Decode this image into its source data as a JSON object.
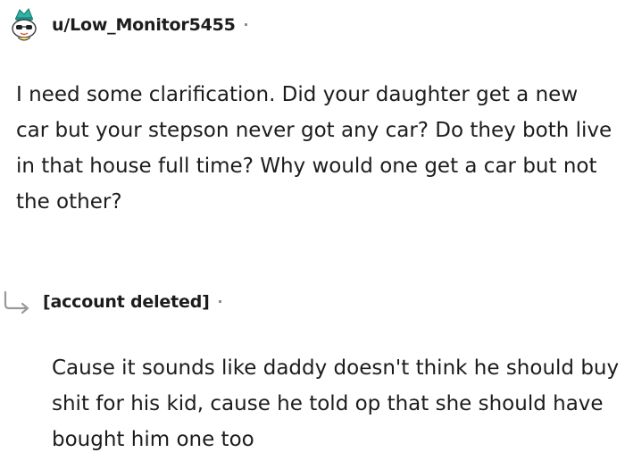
{
  "comment": {
    "username": "u/Low_Monitor5455",
    "separator": "·",
    "avatar_icon": "snoo-avatar-icon",
    "body": "I need some clarification. Did your daughter get a new car but your stepson never got any car? Do they both live in that house full time? Why would one get a car but not the other?"
  },
  "reply": {
    "arrow_icon": "reply-arrow-icon",
    "username": "[account deleted]",
    "separator": "·",
    "body": "Cause it sounds like daddy doesn't think he should buy shit for his kid, cause he told op that she should have bought him one too"
  },
  "colors": {
    "text": "#1c1c1c",
    "muted": "#7c7c7c",
    "avatar_accent": "#2bb5a8"
  }
}
